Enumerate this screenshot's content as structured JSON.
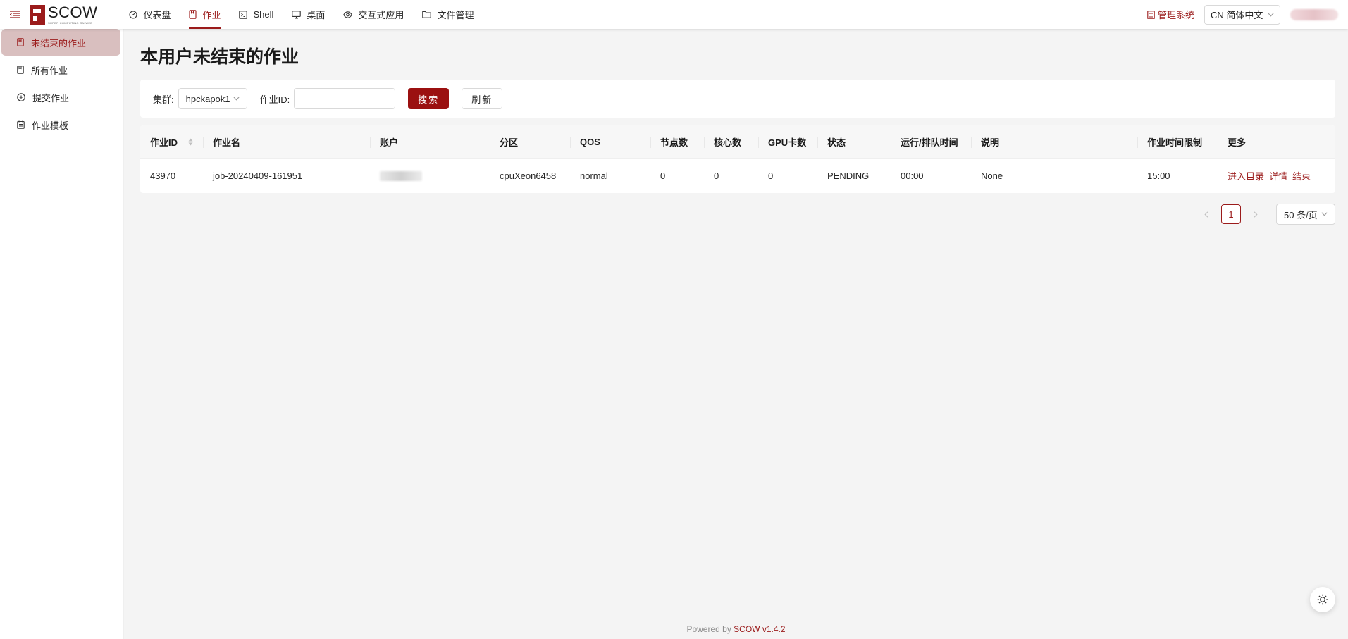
{
  "app": {
    "logo_name": "SCOW",
    "logo_subtitle": "SUPER COMPUTING ON WEB"
  },
  "header": {
    "nav": [
      {
        "label": "仪表盘",
        "icon": "dashboard-icon",
        "active": false
      },
      {
        "label": "作业",
        "icon": "job-icon",
        "active": true
      },
      {
        "label": "Shell",
        "icon": "shell-icon",
        "active": false
      },
      {
        "label": "桌面",
        "icon": "desktop-icon",
        "active": false
      },
      {
        "label": "交互式应用",
        "icon": "eye-icon",
        "active": false
      },
      {
        "label": "文件管理",
        "icon": "folder-icon",
        "active": false
      }
    ],
    "management_link": "管理系统",
    "language_select": "CN 简体中文"
  },
  "sidebar": {
    "items": [
      {
        "label": "未结束的作业",
        "icon": "job-icon",
        "active": true
      },
      {
        "label": "所有作业",
        "icon": "job-icon",
        "active": false
      },
      {
        "label": "提交作业",
        "icon": "plus-circle-icon",
        "active": false
      },
      {
        "label": "作业模板",
        "icon": "template-icon",
        "active": false
      }
    ]
  },
  "main": {
    "title": "本用户未结束的作业",
    "filter": {
      "cluster_label": "集群:",
      "cluster_value": "hpckapok1",
      "jobid_label": "作业ID:",
      "jobid_value": "",
      "search_button": "搜索",
      "refresh_button": "刷新"
    },
    "table": {
      "columns": [
        "作业ID",
        "作业名",
        "账户",
        "分区",
        "QOS",
        "节点数",
        "核心数",
        "GPU卡数",
        "状态",
        "运行/排队时间",
        "说明",
        "作业时间限制",
        "更多"
      ],
      "rows": [
        {
          "job_id": "43970",
          "job_name": "job-20240409-161951",
          "account": "",
          "partition": "cpuXeon6458",
          "qos": "normal",
          "nodes": "0",
          "cores": "0",
          "gpus": "0",
          "state": "PENDING",
          "run_time": "00:00",
          "reason": "None",
          "time_limit": "15:00",
          "actions": [
            "进入目录",
            "详情",
            "结束"
          ]
        }
      ]
    },
    "pagination": {
      "current_page": "1",
      "page_size": "50 条/页"
    }
  },
  "footer": {
    "prefix": "Powered by ",
    "brand": "SCOW",
    "version": " v1.4.2"
  },
  "colors": {
    "brand": "#9b1b1b",
    "primary_button": "#9b1010",
    "sidebar_active_bg": "#d9bfbf",
    "page_bg": "#f4f4f4"
  }
}
